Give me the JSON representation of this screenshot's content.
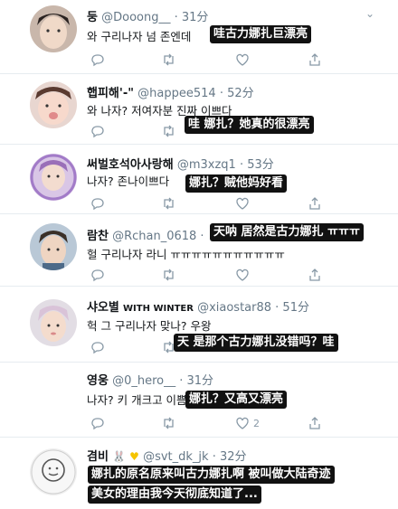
{
  "tweets": [
    {
      "name": "둥",
      "handle": "@Dooong__",
      "time": "· 31分",
      "text": "와 구리나자 넘 존엔데",
      "overlays": [
        "哇古力娜扎巨漂亮"
      ],
      "reply_count": "",
      "retweet_count": "",
      "like_count": ""
    },
    {
      "name": "햅피해'-\"",
      "handle": "@happee514",
      "time": "· 52分",
      "text": "와 나자? 저여자분 진짜 이쁘다",
      "overlays": [
        "哇 娜扎？她真的很漂亮"
      ],
      "reply_count": "",
      "retweet_count": "",
      "like_count": ""
    },
    {
      "name": "써벌호석아사랑해",
      "handle": "@m3xzq1",
      "time": "· 53分",
      "text": "나자? 존나이쁘다",
      "overlays": [
        "娜扎？贼他妈好看"
      ],
      "reply_count": "",
      "retweet_count": "",
      "like_count": ""
    },
    {
      "name": "람찬",
      "handle": "@Rchan_0618",
      "time": "·",
      "text": "헐 구리나자 라니 ㅠㅠㅠㅠㅠㅠㅠㅠㅠㅠㅠ",
      "overlays": [
        "天呐 居然是古力娜扎 ㅠㅠㅠ"
      ],
      "reply_count": "",
      "retweet_count": "",
      "like_count": ""
    },
    {
      "name": "샤오별",
      "badge": "WITH WINTER",
      "handle": "@xiaostar88",
      "time": "· 51分",
      "text": "헉 그 구리나자 맞나? 우왕",
      "overlays": [
        "天 是那个古力娜扎没错吗？哇"
      ],
      "reply_count": "",
      "retweet_count": "",
      "like_count": ""
    },
    {
      "name": "영웅",
      "handle": "@0_hero__",
      "time": "· 31分",
      "text": "나자? 키 개크고 이쁨",
      "overlays": [
        "娜扎？又高又漂亮"
      ],
      "reply_count": "",
      "retweet_count": "",
      "like_count": "2"
    },
    {
      "name": "겸비",
      "handle": "@svt_dk_jk",
      "time": "· 32分",
      "text": "",
      "overlays": [
        "娜扎的原名原来叫古力娜扎啊 被叫做大陆奇迹",
        "美女的理由我今天彻底知道了..."
      ],
      "reply_count": "",
      "retweet_count": "",
      "like_count": ""
    }
  ],
  "colors": {
    "icon": "#8899a6",
    "divider": "#e6ecf0",
    "overlay_bg": "#111111",
    "overlay_text": "#ffffff"
  }
}
